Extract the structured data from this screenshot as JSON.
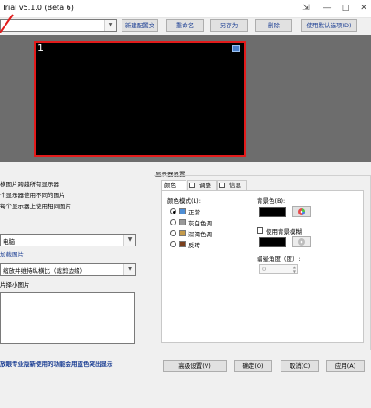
{
  "window": {
    "title": "Trial v5.1.0 (Beta 6)",
    "controls": [
      "⇲",
      "—",
      "□",
      "✕"
    ]
  },
  "toolbar": {
    "new_config": "新建配置文",
    "rename": "重命名",
    "save_as": "另存为",
    "delete": "删除",
    "use_defaults": "使用默认选项(D)"
  },
  "preview": {
    "monitor_number": "1"
  },
  "left_options": {
    "radio1": "横图片跨越所有显示器",
    "radio2": "个显示器使用不同的图片",
    "radio3": "每个显示器上使用相同图片",
    "combo1": "电脑",
    "link1": "加载图片",
    "combo2": "缩放并维持纵横比（裁剪边缘）",
    "label_small": "片择小图片",
    "footer_note": "放眼专业版新使用的功能会用蓝色突出显示"
  },
  "display_settings": {
    "group_title": "显示器设置",
    "tabs": [
      "颜色",
      "调整",
      "信息"
    ],
    "color_mode_label": "颜色模式(L):",
    "modes": [
      "正常",
      "灰白色调",
      "深褐色调",
      "反转"
    ],
    "mode_colors": [
      "#4f8fd6",
      "#9a9a9a",
      "#c49a4a",
      "#7a3f1c"
    ],
    "bg_color_label": "背景色(B):",
    "use_bg_blur": "使用背景模糊",
    "blur_angle_label": "弱晕角度（度）:",
    "blur_angle_value": "0"
  },
  "bottom_buttons": {
    "advanced": "高级设置(V)",
    "ok": "确定(O)",
    "cancel": "取消(C)",
    "apply": "应用(A)"
  }
}
